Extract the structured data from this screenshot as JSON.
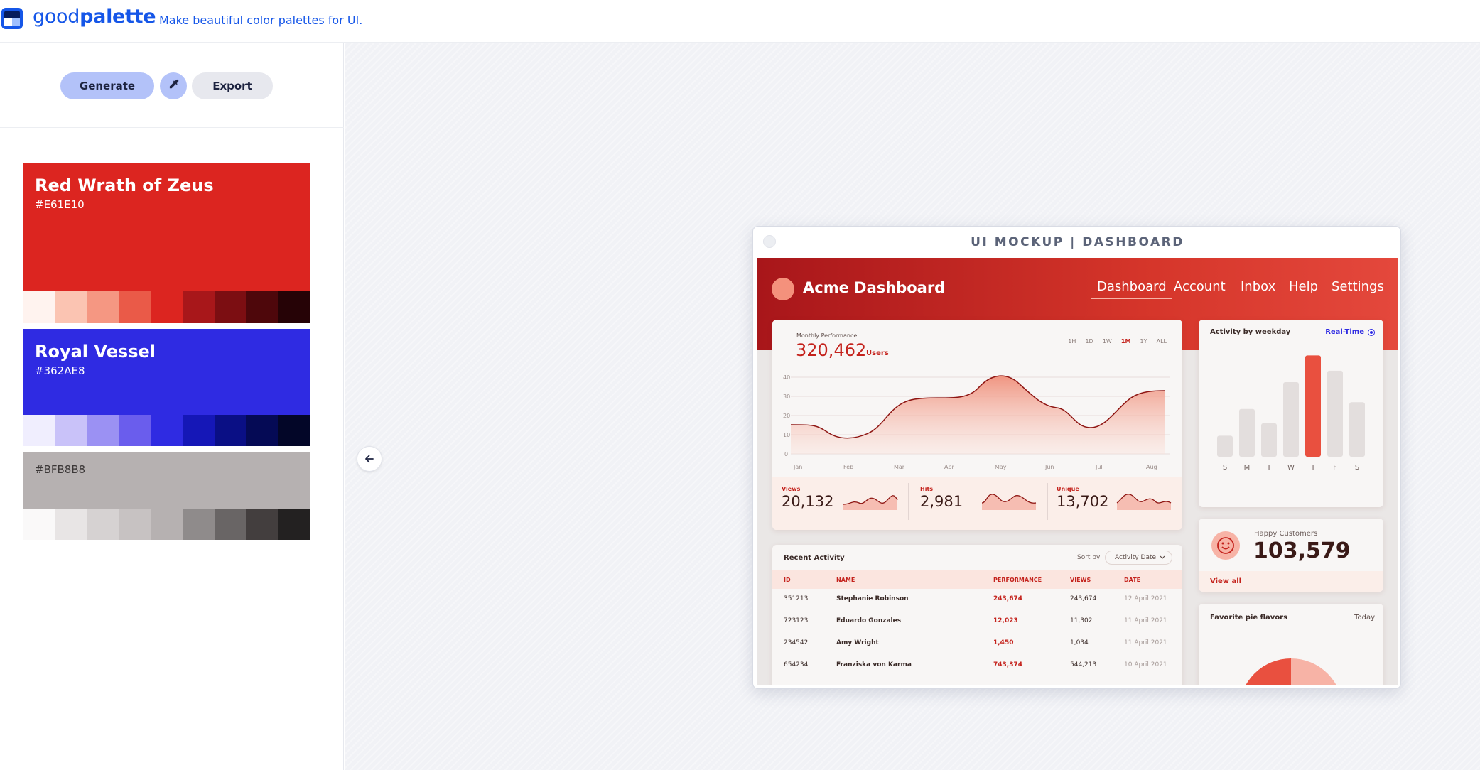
{
  "app": {
    "brand_light": "good",
    "brand_bold": "palette",
    "tagline": "Make beautiful color palettes for UI."
  },
  "toolbar": {
    "generate_label": "Generate",
    "export_label": "Export",
    "picker_icon": "eyedropper-icon"
  },
  "palettes": [
    {
      "name": "Red Wrath of Zeus",
      "hex": "#E61E10",
      "color": "#dc2520",
      "shades": [
        "#fff3ef",
        "#fbc4b2",
        "#f59782",
        "#ea5a48",
        "#dc2520",
        "#a8171a",
        "#7c0e12",
        "#4e070b",
        "#260306"
      ]
    },
    {
      "name": "Royal Vessel",
      "hex": "#362AE8",
      "color": "#2f2be2",
      "shades": [
        "#f0eefe",
        "#c9c2f9",
        "#9b91f3",
        "#6a5ded",
        "#2f2be2",
        "#1517b7",
        "#0a0f85",
        "#050a55",
        "#030628"
      ]
    },
    {
      "name": "",
      "hex": "#BFB8B8",
      "color": "#b6b1b1",
      "shades": [
        "#faf9f9",
        "#e8e5e5",
        "#d6d2d2",
        "#c7c2c2",
        "#b6b1b1",
        "#8f8b8b",
        "#696565",
        "#433e3e",
        "#232121"
      ]
    }
  ],
  "mockup": {
    "frame_title": "UI MOCKUP | DASHBOARD",
    "app_title": "Acme Dashboard",
    "nav": [
      "Dashboard",
      "Account",
      "Inbox",
      "Help",
      "Settings"
    ],
    "performance": {
      "label": "Monthly Performance",
      "value": "320,462",
      "unit": "Users",
      "ranges": [
        "1H",
        "1D",
        "1W",
        "1M",
        "1Y",
        "ALL"
      ],
      "active_range": "1M",
      "y_ticks": [
        "40",
        "30",
        "20",
        "10",
        "0"
      ],
      "months": [
        "Jan",
        "Feb",
        "Mar",
        "Apr",
        "May",
        "Jun",
        "Jul",
        "Aug"
      ]
    },
    "stats": [
      {
        "label": "Views",
        "value": "20,132"
      },
      {
        "label": "Hits",
        "value": "2,981"
      },
      {
        "label": "Unique",
        "value": "13,702"
      }
    ],
    "weekday": {
      "title": "Activity by weekday",
      "realtime_label": "Real-Time",
      "days": [
        "S",
        "M",
        "T",
        "W",
        "T",
        "F",
        "S"
      ],
      "values": [
        22,
        50,
        35,
        78,
        106,
        90,
        57
      ],
      "highlight_index": 4
    },
    "customers": {
      "label": "Happy Customers",
      "value": "103,579",
      "link": "View all"
    },
    "pie": {
      "title": "Favorite pie flavors",
      "period": "Today"
    },
    "activity": {
      "title": "Recent Activity",
      "sort_label": "Sort by",
      "sort_value": "Activity Date",
      "columns": [
        "ID",
        "NAME",
        "PERFORMANCE",
        "VIEWS",
        "DATE"
      ],
      "rows": [
        [
          "351213",
          "Stephanie Robinson",
          "243,674",
          "243,674",
          "12 April 2021"
        ],
        [
          "723123",
          "Eduardo Gonzales",
          "12,023",
          "11,302",
          "11 April 2021"
        ],
        [
          "234542",
          "Amy Wright",
          "1,450",
          "1,034",
          "11 April 2021"
        ],
        [
          "654234",
          "Franziska von Karma",
          "743,374",
          "544,213",
          "10 April 2021"
        ]
      ]
    }
  }
}
